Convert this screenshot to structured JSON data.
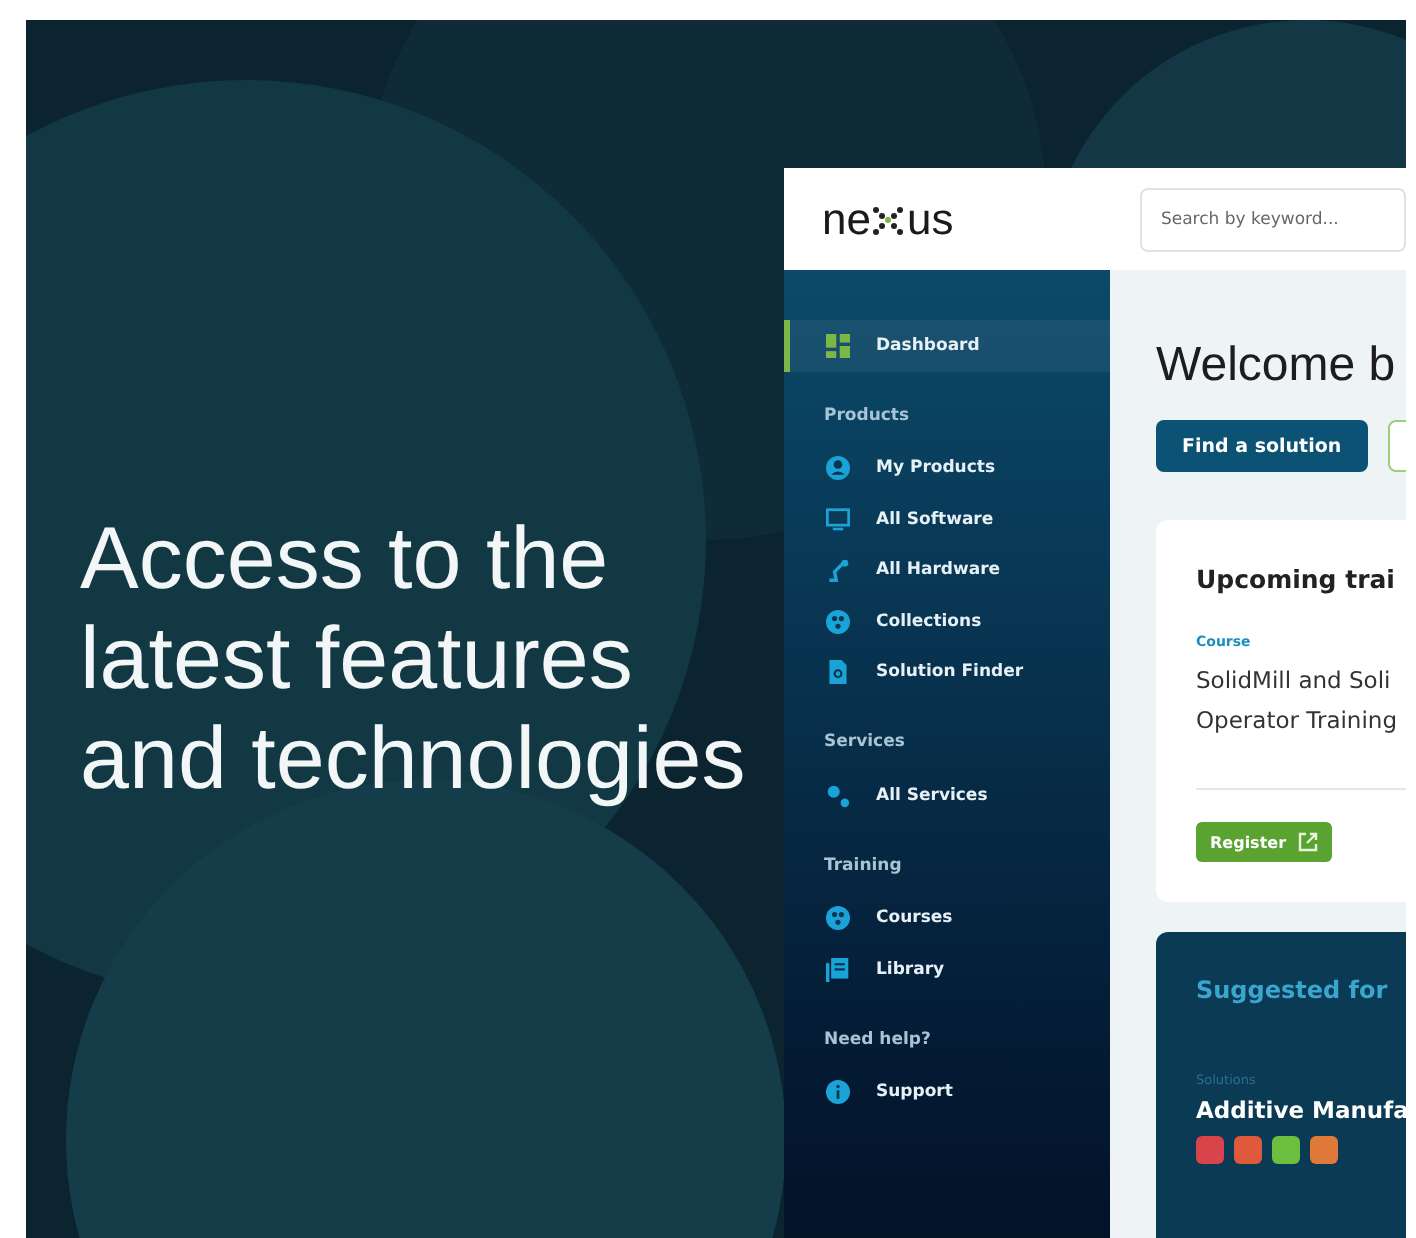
{
  "headline": "Access to the latest features and technologies",
  "app": {
    "logo": {
      "text_start": "ne",
      "text_end": "us"
    },
    "search": {
      "placeholder": "Search by keyword..."
    },
    "sidebar": {
      "sections": [
        {
          "items": [
            {
              "label": "Dashboard",
              "selected": true
            }
          ]
        },
        {
          "title": "Products",
          "items": [
            {
              "label": "My Products",
              "selected": false
            },
            {
              "label": "All Software",
              "selected": false
            },
            {
              "label": "All Hardware",
              "selected": false
            },
            {
              "label": "Collections",
              "selected": false
            },
            {
              "label": "Solution Finder",
              "selected": false
            }
          ]
        },
        {
          "title": "Services",
          "items": [
            {
              "label": "All Services",
              "selected": false
            }
          ]
        },
        {
          "title": "Training",
          "items": [
            {
              "label": "Courses",
              "selected": false
            },
            {
              "label": "Library",
              "selected": false
            }
          ]
        },
        {
          "title": "Need help?",
          "items": [
            {
              "label": "Support",
              "selected": false
            }
          ]
        }
      ]
    },
    "main": {
      "heading": "Welcome b",
      "primary_button": "Find a solution",
      "training_card": {
        "title": "Upcoming trai",
        "category": "Course",
        "lines": [
          "SolidMill and Soli",
          "Operator Training"
        ],
        "button": "Register"
      },
      "suggested_card": {
        "title": "Suggested for",
        "category": "Solutions",
        "item": "Additive Manufa"
      }
    }
  }
}
